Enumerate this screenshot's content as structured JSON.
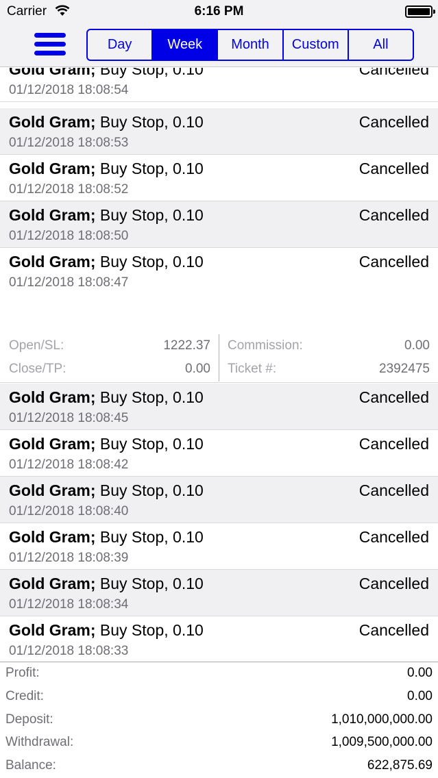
{
  "status_bar": {
    "carrier": "Carrier",
    "time": "6:16 PM"
  },
  "nav": {
    "segments": [
      {
        "label": "Day",
        "active": false
      },
      {
        "label": "Week",
        "active": true
      },
      {
        "label": "Month",
        "active": false
      },
      {
        "label": "Custom",
        "active": false
      },
      {
        "label": "All",
        "active": false
      }
    ]
  },
  "orders_above": [
    {
      "symbol": "Gold Gram;",
      "desc": " Buy Stop, 0.10",
      "status": "Cancelled",
      "time": "01/12/2018 18:08:54"
    },
    {
      "symbol": "Gold Gram;",
      "desc": " Buy Stop, 0.10",
      "status": "Cancelled",
      "time": "01/12/2018 18:08:53"
    },
    {
      "symbol": "Gold Gram;",
      "desc": " Buy Stop, 0.10",
      "status": "Cancelled",
      "time": "01/12/2018 18:08:52"
    },
    {
      "symbol": "Gold Gram;",
      "desc": " Buy Stop, 0.10",
      "status": "Cancelled",
      "time": "01/12/2018 18:08:50"
    }
  ],
  "expanded_order": {
    "symbol": "Gold Gram;",
    "desc": " Buy Stop, 0.10",
    "status": "Cancelled",
    "time": "01/12/2018 18:08:47",
    "open_sl_label": "Open/SL:",
    "open_sl": "1222.37",
    "close_tp_label": "Close/TP:",
    "close_tp": "0.00",
    "commission_label": "Commission:",
    "commission": "0.00",
    "ticket_label": "Ticket #:",
    "ticket": "2392475"
  },
  "orders_below": [
    {
      "symbol": "Gold Gram;",
      "desc": " Buy Stop, 0.10",
      "status": "Cancelled",
      "time": "01/12/2018 18:08:45"
    },
    {
      "symbol": "Gold Gram;",
      "desc": " Buy Stop, 0.10",
      "status": "Cancelled",
      "time": "01/12/2018 18:08:42"
    },
    {
      "symbol": "Gold Gram;",
      "desc": " Buy Stop, 0.10",
      "status": "Cancelled",
      "time": "01/12/2018 18:08:40"
    },
    {
      "symbol": "Gold Gram;",
      "desc": " Buy Stop, 0.10",
      "status": "Cancelled",
      "time": "01/12/2018 18:08:39"
    },
    {
      "symbol": "Gold Gram;",
      "desc": " Buy Stop, 0.10",
      "status": "Cancelled",
      "time": "01/12/2018 18:08:34"
    },
    {
      "symbol": "Gold Gram;",
      "desc": " Buy Stop, 0.10",
      "status": "Cancelled",
      "time": "01/12/2018 18:08:33"
    }
  ],
  "summary": [
    {
      "label": "Profit:",
      "value": "0.00"
    },
    {
      "label": "Credit:",
      "value": "0.00"
    },
    {
      "label": "Deposit:",
      "value": "1,010,000,000.00"
    },
    {
      "label": "Withdrawal:",
      "value": "1,009,500,000.00"
    },
    {
      "label": "Balance:",
      "value": "622,875.69"
    }
  ],
  "colors": {
    "accent": "#0000e6",
    "row_alt": "#f0f0f3",
    "muted": "#6e6e73"
  }
}
